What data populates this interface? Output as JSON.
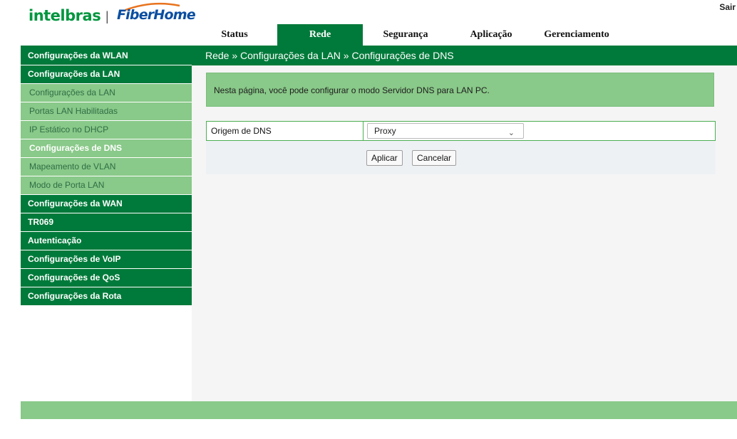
{
  "brand": {
    "intelbras": "intelbras",
    "separator": "|",
    "fiberhome": "FiberHome"
  },
  "header": {
    "logout": "Sair"
  },
  "tabs": [
    {
      "label": "Status",
      "active": false
    },
    {
      "label": "Rede",
      "active": true
    },
    {
      "label": "Segurança",
      "active": false
    },
    {
      "label": "Aplicação",
      "active": false
    },
    {
      "label": "Gerenciamento",
      "active": false
    }
  ],
  "breadcrumb": "Rede » Configurações da LAN » Configurações de DNS",
  "sidebar": {
    "items": [
      {
        "label": "Configurações da WLAN",
        "level": 1
      },
      {
        "label": "Configurações da LAN",
        "level": 1
      },
      {
        "label": "Configurações da LAN",
        "level": 2
      },
      {
        "label": "Portas LAN Habilitadas",
        "level": 2
      },
      {
        "label": "IP Estático no DHCP",
        "level": 2
      },
      {
        "label": "Configurações de DNS",
        "level": 2,
        "selected": true
      },
      {
        "label": "Mapeamento de VLAN",
        "level": 2
      },
      {
        "label": "Modo de Porta LAN",
        "level": 2
      },
      {
        "label": "Configurações da WAN",
        "level": 1
      },
      {
        "label": "TR069",
        "level": 1
      },
      {
        "label": "Autenticação",
        "level": 1
      },
      {
        "label": "Configurações de VoIP",
        "level": 1
      },
      {
        "label": "Configurações de QoS",
        "level": 1
      },
      {
        "label": "Configurações da Rota",
        "level": 1
      }
    ]
  },
  "main": {
    "info": "Nesta página, você pode configurar o modo Servidor DNS para LAN PC.",
    "dns_origin": {
      "label": "Origem de DNS",
      "value": "Proxy"
    },
    "apply_label": "Aplicar",
    "cancel_label": "Cancelar"
  },
  "colors": {
    "primary_green": "#007a3a",
    "light_green": "#89c989",
    "fiberhome_blue": "#0a4ea0"
  }
}
